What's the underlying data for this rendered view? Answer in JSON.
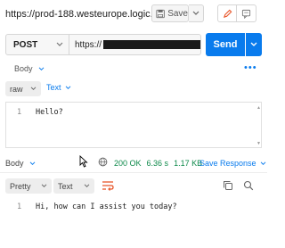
{
  "header": {
    "title": "https://prod-188.westeurope.logic....",
    "save_label": "Save"
  },
  "request": {
    "method": "POST",
    "url_prefix": "https://",
    "send_label": "Send"
  },
  "request_tabs": {
    "body_label": "Body",
    "more_label": "•••"
  },
  "body_options": {
    "mode": "raw",
    "language": "Text"
  },
  "editor": {
    "line_number": "1",
    "content": "Hello?"
  },
  "response": {
    "tab_label": "Body",
    "status": "200 OK",
    "time": "6.36 s",
    "size": "1.17 KB",
    "save_label": "Save Response",
    "format": "Pretty",
    "language": "Text",
    "line_number": "1",
    "content": "Hi, how can I assist you today?"
  },
  "colors": {
    "accent": "#097bed",
    "status_ok": "#0f8a4b"
  },
  "icons": [
    "save-icon",
    "chevron-down-icon",
    "pencil-icon",
    "comment-icon",
    "globe-icon",
    "cursor-icon",
    "wrap-icon",
    "copy-icon",
    "search-icon"
  ]
}
